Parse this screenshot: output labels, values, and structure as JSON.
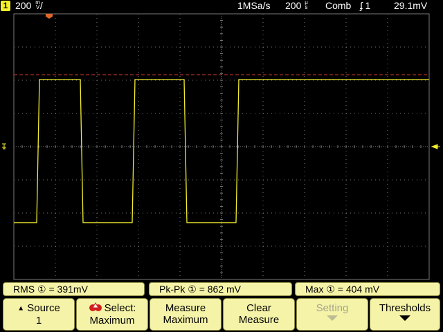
{
  "header": {
    "channel": "1",
    "volts_per_div": "200",
    "volts_unit_top": "m",
    "volts_unit_bottom": "V",
    "volts_suffix": "/",
    "sample_rate": "1MSa/s",
    "time_per_div": "200",
    "time_unit_top": "μ",
    "time_unit_bottom": "s",
    "acq_mode": "Comb",
    "trigger_symbol": "ʄ",
    "trigger_source": "1",
    "trigger_level": "29.1mV"
  },
  "trace": {
    "color": "#f4ef2d",
    "description": "square wave",
    "levels": {
      "high": 404,
      "low": -458
    },
    "transitions_time_div": [
      0.55,
      1.6,
      2.85,
      4.1,
      5.35
    ],
    "starts_low": true
  },
  "display": {
    "grid_divisions": [
      10,
      8
    ],
    "grid_color": "#7a7a7a",
    "cursor_line_color": "#d23a2e"
  },
  "measurements": [
    {
      "name": "RMS",
      "source_icon": "①",
      "equals": "=",
      "value": "391mV"
    },
    {
      "name": "Pk-Pk",
      "source_icon": "①",
      "equals": "=",
      "value": "862 mV"
    },
    {
      "name": "Max",
      "source_icon": "①",
      "equals": "=",
      "value": "404 mV"
    }
  ],
  "softkeys": [
    {
      "line1": "Source",
      "line2": "1",
      "prefix_icon": "▲",
      "disabled": false
    },
    {
      "line1": "Select:",
      "line2": "Maximum",
      "prefix_icon": "ruler-icon",
      "disabled": false
    },
    {
      "line1": "Measure",
      "line2": "Maximum",
      "disabled": false
    },
    {
      "line1": "Clear",
      "line2": "Measure",
      "disabled": false
    },
    {
      "line1": "Setting",
      "line2": "",
      "arrow": true,
      "disabled": true
    },
    {
      "line1": "Thresholds",
      "line2": "",
      "arrow": true,
      "disabled": false
    }
  ]
}
